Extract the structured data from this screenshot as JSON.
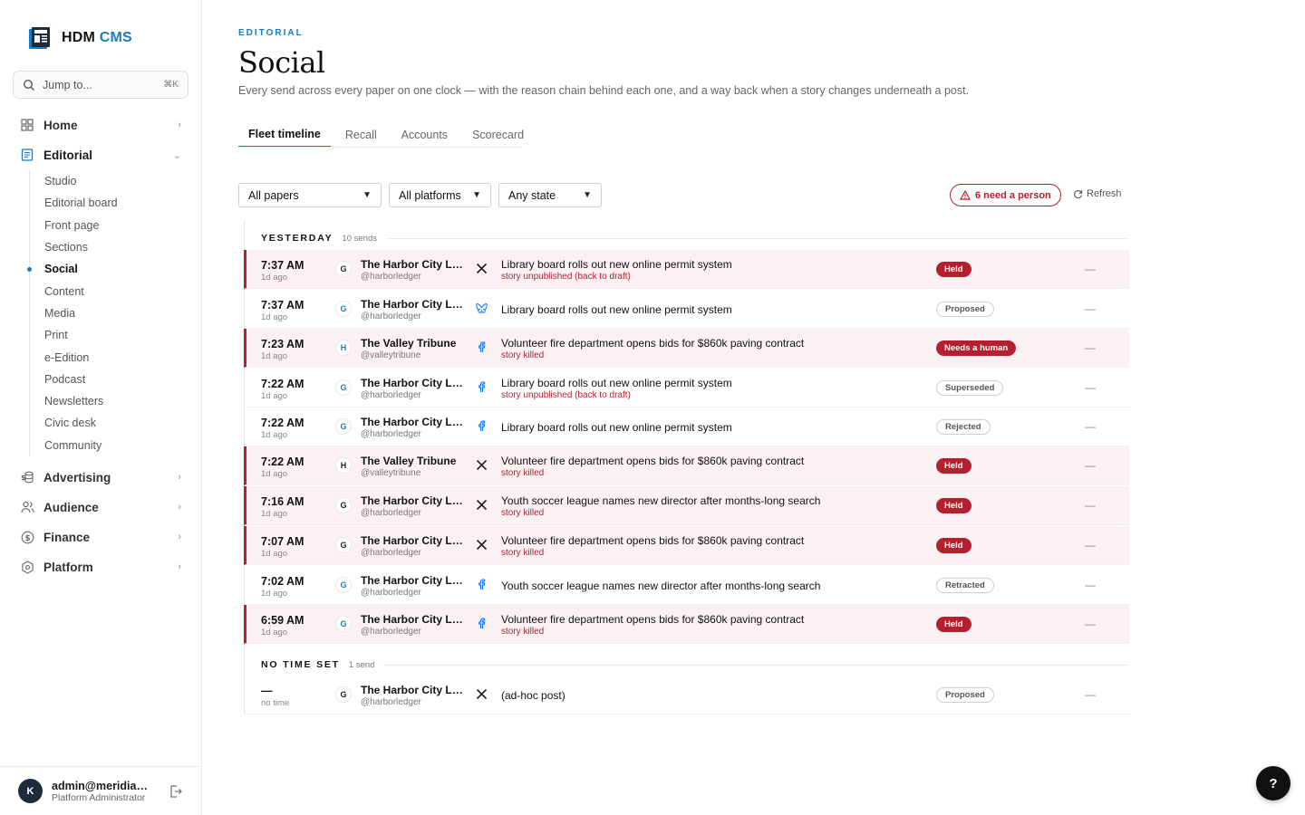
{
  "brand": {
    "hdm": "HDM",
    "cms": "CMS"
  },
  "search": {
    "label": "Jump to...",
    "shortcut": "⌘K"
  },
  "nav": {
    "home": "Home",
    "editorial": "Editorial",
    "advertising": "Advertising",
    "audience": "Audience",
    "finance": "Finance",
    "platform": "Platform"
  },
  "subnav": [
    "Studio",
    "Editorial board",
    "Front page",
    "Sections",
    "Social",
    "Content",
    "Media",
    "Print",
    "e-Edition",
    "Podcast",
    "Newsletters",
    "Civic desk",
    "Community"
  ],
  "user": {
    "initial": "K",
    "email": "admin@meridian.n...",
    "role": "Platform Administrator"
  },
  "header": {
    "eyebrow": "EDITORIAL",
    "title": "Social",
    "subtitle": "Every send across every paper on one clock — with the reason chain behind each one, and a way back when a story changes underneath a post."
  },
  "tabs": [
    "Fleet timeline",
    "Recall",
    "Accounts",
    "Scorecard"
  ],
  "filters": {
    "papers": "All papers",
    "platforms": "All platforms",
    "state": "Any state"
  },
  "alert": {
    "label": "6 need a person"
  },
  "refresh": {
    "label": "Refresh"
  },
  "groups": [
    {
      "label": "YESTERDAY",
      "count": "10 sends"
    },
    {
      "label": "NO TIME SET",
      "count": "1 send"
    }
  ],
  "rows": [
    {
      "time": "7:37 AM",
      "ago": "1d ago",
      "badge": "G",
      "account": "The Harbor City Led...",
      "handle": "@harborledger",
      "platform": "x",
      "headline": "Library board rolls out new online permit system",
      "reason": "story unpublished (back to draft)",
      "state": "Held",
      "dash": "—"
    },
    {
      "time": "7:37 AM",
      "ago": "1d ago",
      "badge": "G",
      "account": "The Harbor City Led...",
      "handle": "@harborledger",
      "platform": "bluesky",
      "headline": "Library board rolls out new online permit system",
      "reason": "",
      "state": "Proposed",
      "dash": "—"
    },
    {
      "time": "7:23 AM",
      "ago": "1d ago",
      "badge": "H",
      "account": "The Valley Tribune",
      "handle": "@valleytribune",
      "platform": "facebook",
      "headline": "Volunteer fire department opens bids for $860k paving contract",
      "reason": "story killed",
      "state": "Needs a human",
      "dash": "—"
    },
    {
      "time": "7:22 AM",
      "ago": "1d ago",
      "badge": "G",
      "account": "The Harbor City Led...",
      "handle": "@harborledger",
      "platform": "facebook",
      "headline": "Library board rolls out new online permit system",
      "reason": "story unpublished (back to draft)",
      "state": "Superseded",
      "dash": "—"
    },
    {
      "time": "7:22 AM",
      "ago": "1d ago",
      "badge": "G",
      "account": "The Harbor City Led...",
      "handle": "@harborledger",
      "platform": "facebook",
      "headline": "Library board rolls out new online permit system",
      "reason": "",
      "state": "Rejected",
      "dash": "—"
    },
    {
      "time": "7:22 AM",
      "ago": "1d ago",
      "badge": "H",
      "account": "The Valley Tribune",
      "handle": "@valleytribune",
      "platform": "x",
      "headline": "Volunteer fire department opens bids for $860k paving contract",
      "reason": "story killed",
      "state": "Held",
      "dash": "—"
    },
    {
      "time": "7:16 AM",
      "ago": "1d ago",
      "badge": "G",
      "account": "The Harbor City Led...",
      "handle": "@harborledger",
      "platform": "x",
      "headline": "Youth soccer league names new director after months-long search",
      "reason": "story killed",
      "state": "Held",
      "dash": "—"
    },
    {
      "time": "7:07 AM",
      "ago": "1d ago",
      "badge": "G",
      "account": "The Harbor City Led...",
      "handle": "@harborledger",
      "platform": "x",
      "headline": "Volunteer fire department opens bids for $860k paving contract",
      "reason": "story killed",
      "state": "Held",
      "dash": "—"
    },
    {
      "time": "7:02 AM",
      "ago": "1d ago",
      "badge": "G",
      "account": "The Harbor City Led...",
      "handle": "@harborledger",
      "platform": "facebook",
      "headline": "Youth soccer league names new director after months-long search",
      "reason": "",
      "state": "Retracted",
      "dash": "—"
    },
    {
      "time": "6:59 AM",
      "ago": "1d ago",
      "badge": "G",
      "account": "The Harbor City Led...",
      "handle": "@harborledger",
      "platform": "facebook",
      "headline": "Volunteer fire department opens bids for $860k paving contract",
      "reason": "story killed",
      "state": "Held",
      "dash": "—"
    },
    {
      "time": "—",
      "ago": "no time",
      "badge": "G",
      "account": "The Harbor City Led...",
      "handle": "@harborledger",
      "platform": "x",
      "headline": "(ad-hoc post)",
      "reason": "",
      "state": "Proposed",
      "dash": "—"
    }
  ],
  "help": {
    "label": "?"
  },
  "colors": {
    "accent": "#1a7bbf",
    "danger": "#b3202f"
  }
}
